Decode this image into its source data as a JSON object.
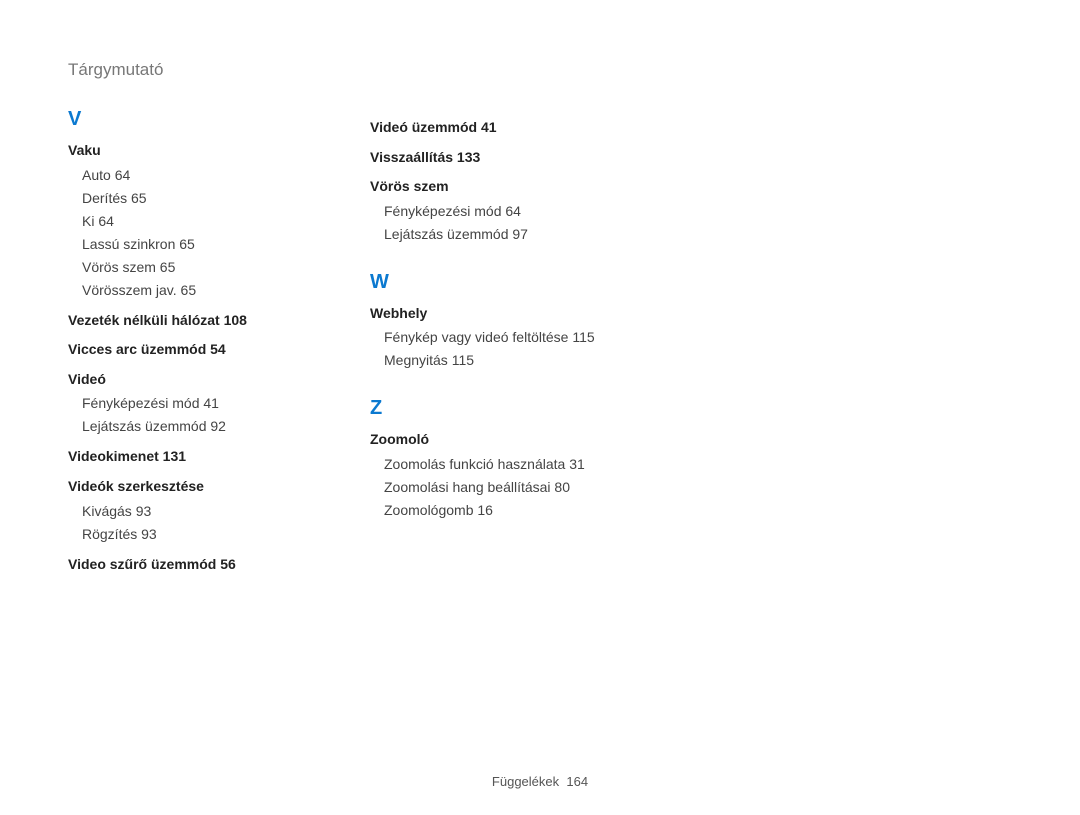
{
  "header": {
    "title": "Tárgymutató"
  },
  "footer": {
    "label": "Függelékek",
    "page": "164"
  },
  "col1": [
    {
      "type": "letter",
      "text": "V"
    },
    {
      "type": "term",
      "text": "Vaku"
    },
    {
      "type": "sub",
      "text": "Auto  64"
    },
    {
      "type": "sub",
      "text": "Derítés  65"
    },
    {
      "type": "sub",
      "text": "Ki  64"
    },
    {
      "type": "sub",
      "text": "Lassú szinkron  65"
    },
    {
      "type": "sub",
      "text": "Vörös szem  65"
    },
    {
      "type": "sub",
      "text": "Vörösszem jav.  65"
    },
    {
      "type": "termpg",
      "text": "Vezeték nélküli hálózat  108"
    },
    {
      "type": "termpg",
      "text": "Vicces arc üzemmód  54"
    },
    {
      "type": "term",
      "text": "Videó"
    },
    {
      "type": "sub",
      "text": "Fényképezési mód  41"
    },
    {
      "type": "sub",
      "text": "Lejátszás üzemmód  92"
    },
    {
      "type": "termpg",
      "text": "Videokimenet  131"
    },
    {
      "type": "term",
      "text": "Videók szerkesztése"
    },
    {
      "type": "sub",
      "text": "Kivágás  93"
    },
    {
      "type": "sub",
      "text": "Rögzítés  93"
    },
    {
      "type": "termpg",
      "text": "Video szűrő üzemmód  56"
    }
  ],
  "col2": [
    {
      "type": "termpg",
      "text": "Videó üzemmód  41"
    },
    {
      "type": "termpg",
      "text": "Visszaállítás  133"
    },
    {
      "type": "term",
      "text": "Vörös szem"
    },
    {
      "type": "sub",
      "text": "Fényképezési mód  64"
    },
    {
      "type": "sub",
      "text": "Lejátszás üzemmód  97"
    },
    {
      "type": "spacer"
    },
    {
      "type": "letter",
      "text": "W"
    },
    {
      "type": "term",
      "text": "Webhely"
    },
    {
      "type": "sub",
      "text": "Fénykép vagy videó feltöltése  115"
    },
    {
      "type": "sub",
      "text": "Megnyitás  115"
    },
    {
      "type": "spacer"
    },
    {
      "type": "letter",
      "text": "Z"
    },
    {
      "type": "term",
      "text": "Zoomoló"
    },
    {
      "type": "sub",
      "text": "Zoomolás funkció használata  31"
    },
    {
      "type": "sub",
      "text": "Zoomolási hang beállításai  80"
    },
    {
      "type": "sub",
      "text": "Zoomológomb  16"
    }
  ]
}
